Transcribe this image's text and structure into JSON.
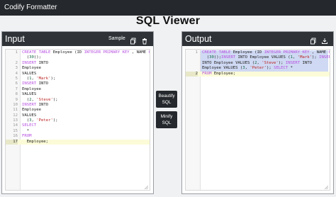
{
  "app": {
    "brand": "Codify Formatter"
  },
  "page": {
    "title": "SQL Viewer"
  },
  "input": {
    "title": "Input",
    "sample_label": "Sample",
    "lines": [
      {
        "n": "1",
        "t": [
          [
            "k",
            "CREATE TABLE"
          ],
          [
            "",
            "Employee (ID "
          ],
          [
            "k",
            "INTEGER PRIMARY KEY"
          ],
          [
            "",
            ", NAME "
          ],
          [
            "k",
            "CHAR"
          ]
        ]
      },
      {
        "n": "",
        "t": [
          [
            "",
            "  ("
          ],
          [
            "num",
            "30"
          ],
          [
            "",
            "));"
          ]
        ]
      },
      {
        "n": "2",
        "t": [
          [
            "k",
            "INSERT"
          ],
          [
            "",
            "INTO"
          ]
        ]
      },
      {
        "n": "3",
        "t": [
          [
            "",
            "Employee"
          ]
        ]
      },
      {
        "n": "4",
        "t": [
          [
            "",
            "VALUES"
          ]
        ]
      },
      {
        "n": "5",
        "t": [
          [
            "",
            "  ("
          ],
          [
            "num",
            "1"
          ],
          [
            "",
            ", "
          ],
          [
            "s",
            "'Mark'"
          ],
          [
            "",
            "); "
          ]
        ]
      },
      {
        "n": "6",
        "t": [
          [
            "k",
            "INSERT"
          ],
          [
            "",
            "INTO"
          ]
        ]
      },
      {
        "n": "7",
        "t": [
          [
            "",
            "Employee"
          ]
        ]
      },
      {
        "n": "8",
        "t": [
          [
            "",
            "VALUES"
          ]
        ]
      },
      {
        "n": "9",
        "t": [
          [
            "",
            "  ("
          ],
          [
            "num",
            "2"
          ],
          [
            "",
            ", "
          ],
          [
            "s",
            "'Steve'"
          ],
          [
            "",
            "); "
          ]
        ]
      },
      {
        "n": "10",
        "t": [
          [
            "k",
            "INSERT"
          ],
          [
            "",
            "INTO"
          ]
        ]
      },
      {
        "n": "11",
        "t": [
          [
            "",
            "Employee"
          ]
        ]
      },
      {
        "n": "12",
        "t": [
          [
            "",
            "VALUES"
          ]
        ]
      },
      {
        "n": "13",
        "t": [
          [
            "",
            "  ("
          ],
          [
            "num",
            "3"
          ],
          [
            "",
            ", "
          ],
          [
            "s",
            "'Peter'"
          ],
          [
            "",
            "); "
          ]
        ]
      },
      {
        "n": "14",
        "t": [
          [
            "k",
            "SELECT"
          ]
        ]
      },
      {
        "n": "15",
        "t": [
          [
            "",
            "  *"
          ]
        ]
      },
      {
        "n": "16",
        "t": [
          [
            "k",
            "FROM"
          ]
        ]
      },
      {
        "n": "17",
        "t": [
          [
            "",
            "  Employee;"
          ]
        ]
      }
    ],
    "active_line": 17
  },
  "actions": {
    "beautify_line1": "Beautify",
    "beautify_line2": "SQL",
    "minify_line1": "Minify",
    "minify_line2": "SQL"
  },
  "output": {
    "title": "Output",
    "lines": [
      {
        "n": "1",
        "t": [
          [
            "k",
            "CREATE TABLE"
          ],
          [
            "",
            "Employee (ID "
          ],
          [
            "k",
            "INTEGER PRIMARY KEY"
          ],
          [
            "",
            ", NAME "
          ],
          [
            "k",
            "CHAR"
          ]
        ]
      },
      {
        "n": "",
        "t": [
          [
            "",
            "  ("
          ],
          [
            "num",
            "30"
          ],
          [
            "",
            "));"
          ],
          [
            "k",
            "INSERT"
          ],
          [
            "",
            "INTO Employee VALUES ("
          ],
          [
            "num",
            "1"
          ],
          [
            "",
            ", "
          ],
          [
            "s",
            "'Mark'"
          ],
          [
            "",
            "); "
          ],
          [
            "k",
            "INSERT"
          ]
        ]
      },
      {
        "n": "",
        "t": [
          [
            "",
            "INTO Employee VALUES ("
          ],
          [
            "num",
            "2"
          ],
          [
            "",
            ", "
          ],
          [
            "s",
            "'Steve'"
          ],
          [
            "",
            "); "
          ],
          [
            "k",
            "INSERT"
          ],
          [
            "",
            "INTO"
          ]
        ]
      },
      {
        "n": "",
        "t": [
          [
            "",
            "Employee VALUES ("
          ],
          [
            "num",
            "3"
          ],
          [
            "",
            ", "
          ],
          [
            "s",
            "'Peter'"
          ],
          [
            "",
            "); "
          ],
          [
            "k",
            "SELECT"
          ],
          [
            "",
            "*"
          ]
        ]
      },
      {
        "n": "2",
        "t": [
          [
            "k",
            "FROM"
          ],
          [
            "",
            "Employee;"
          ]
        ]
      }
    ],
    "active_line": 2
  },
  "icons": {
    "copy": "copy-icon",
    "delete": "trash-icon",
    "download": "download-icon"
  }
}
